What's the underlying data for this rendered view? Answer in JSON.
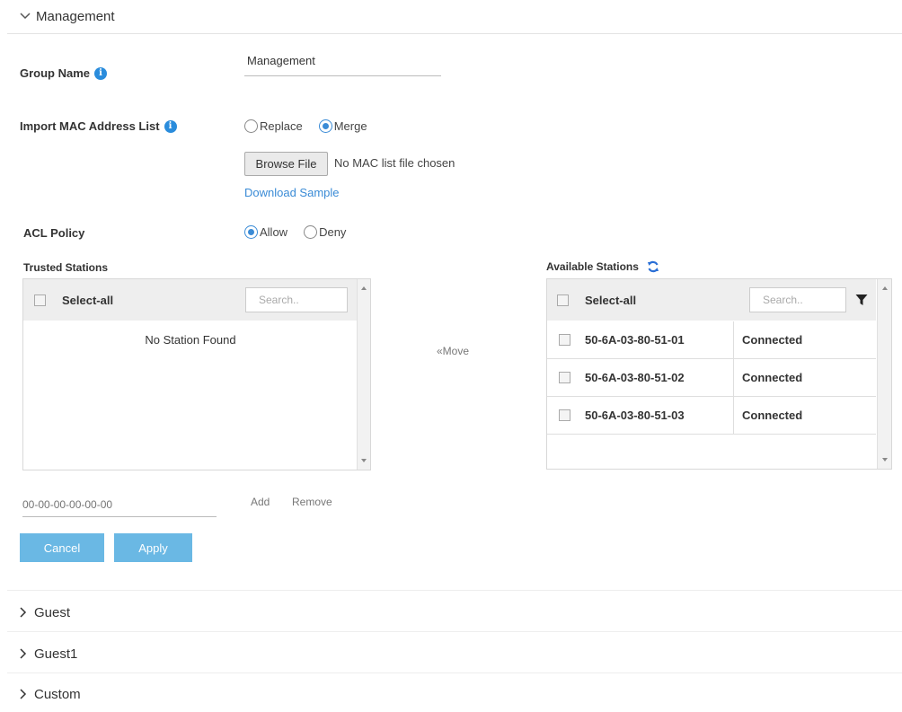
{
  "section": {
    "title": "Management",
    "icon": "chevron-down-icon"
  },
  "group_name": {
    "label": "Group Name",
    "value": "Management",
    "info_icon": "info-icon"
  },
  "import_mac": {
    "label": "Import MAC Address List",
    "options": [
      "Replace",
      "Merge"
    ],
    "selected": "Merge",
    "browse_label": "Browse File",
    "file_status": "No MAC list file chosen",
    "download_link": "Download Sample"
  },
  "acl_policy": {
    "label": "ACL Policy",
    "options": [
      "Allow",
      "Deny"
    ],
    "selected": "Allow"
  },
  "trusted": {
    "title": "Trusted Stations",
    "select_all": "Select-all",
    "search_placeholder": "Search..",
    "empty_message": "No Station Found"
  },
  "move_label": "«Move",
  "available": {
    "title": "Available Stations",
    "refresh_icon": "refresh-icon",
    "filter_icon": "filter-icon",
    "select_all": "Select-all",
    "search_placeholder": "Search..",
    "rows": [
      {
        "mac": "50-6A-03-80-51-01",
        "status": "Connected"
      },
      {
        "mac": "50-6A-03-80-51-02",
        "status": "Connected"
      },
      {
        "mac": "50-6A-03-80-51-03",
        "status": "Connected"
      }
    ]
  },
  "mac_input_placeholder": "00-00-00-00-00-00",
  "add_label": "Add",
  "remove_label": "Remove",
  "cancel_label": "Cancel",
  "apply_label": "Apply",
  "collapsed_sections": [
    {
      "title": "Guest",
      "icon": "chevron-right-icon"
    },
    {
      "title": "Guest1",
      "icon": "chevron-right-icon"
    },
    {
      "title": "Custom",
      "icon": "chevron-right-icon"
    }
  ],
  "colors": {
    "accent": "#3a8bd6",
    "button": "#6ab8e4",
    "panel_header": "#eeeeee"
  }
}
